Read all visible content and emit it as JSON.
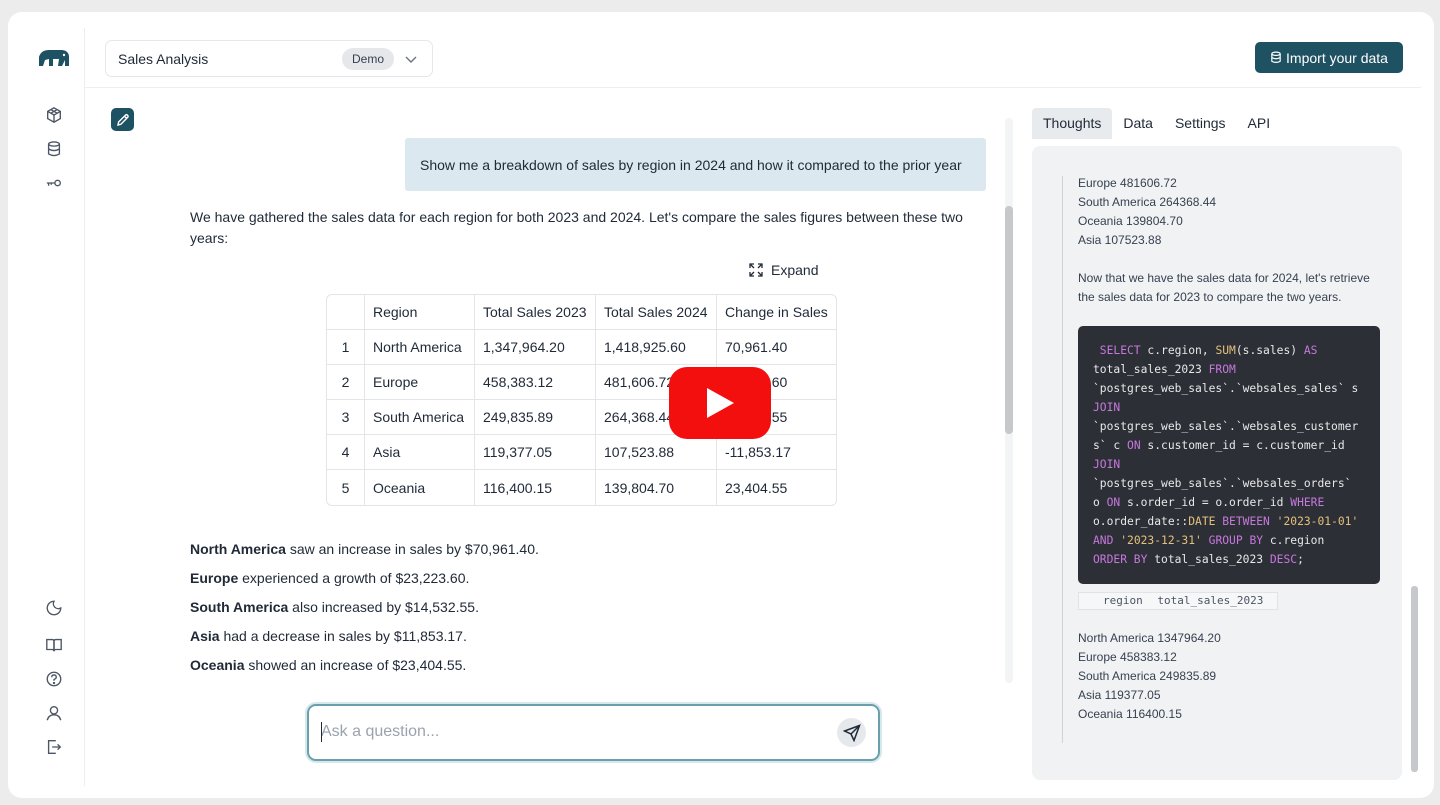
{
  "header": {
    "project_name": "Sales Analysis",
    "project_badge": "Demo",
    "import_label": "Import your data"
  },
  "chat": {
    "user_message": "Show me a breakdown of sales by region in 2024 and how it compared to the prior year",
    "reply_intro": "We have gathered the sales data for each region for both 2023 and 2024. Let's compare the sales figures between these two years:",
    "expand_label": "Expand",
    "table": {
      "headers": [
        "",
        "Region",
        "Total Sales 2023",
        "Total Sales 2024",
        "Change in Sales"
      ],
      "rows": [
        [
          "1",
          "North America",
          "1,347,964.20",
          "1,418,925.60",
          "70,961.40"
        ],
        [
          "2",
          "Europe",
          "458,383.12",
          "481,606.72",
          "23,223.60"
        ],
        [
          "3",
          "South America",
          "249,835.89",
          "264,368.44",
          "14,532.55"
        ],
        [
          "4",
          "Asia",
          "119,377.05",
          "107,523.88",
          "-11,853.17"
        ],
        [
          "5",
          "Oceania",
          "116,400.15",
          "139,804.70",
          "23,404.55"
        ]
      ]
    },
    "summary": [
      {
        "region": "North America",
        "text": " saw an increase in sales by $70,961.40."
      },
      {
        "region": "Europe",
        "text": " experienced a growth of $23,223.60."
      },
      {
        "region": "South America",
        "text": " also increased by $14,532.55."
      },
      {
        "region": "Asia",
        "text": " had a decrease in sales by $11,853.17."
      },
      {
        "region": "Oceania",
        "text": " showed an increase of $23,404.55."
      }
    ],
    "input_placeholder": "Ask a question..."
  },
  "panel": {
    "tabs": [
      "Thoughts",
      "Data",
      "Settings",
      "API"
    ],
    "active_tab": "Thoughts",
    "sales_2024_lines": [
      "Europe 481606.72",
      "South America 264368.44",
      "Oceania 139804.70",
      "Asia 107523.88"
    ],
    "thought": "Now that we have the sales data for 2024, let's retrieve the sales data for 2023 to compare the two years.",
    "sql_lines": [
      " SELECT c.region, SUM(s.sales) AS",
      "total_sales_2023 FROM",
      "`postgres_web_sales`.`websales_sales` s",
      "JOIN",
      "`postgres_web_sales`.`websales_customer",
      "s` c ON s.customer_id = c.customer_id",
      "JOIN",
      "`postgres_web_sales`.`websales_orders`",
      "o ON s.order_id = o.order_id WHERE",
      "o.order_date::DATE BETWEEN '2023-01-01'",
      "AND '2023-12-31' GROUP BY c.region",
      "ORDER BY total_sales_2023 DESC;"
    ],
    "result_columns": [
      "region",
      "total_sales_2023"
    ],
    "sales_2023_lines": [
      "North America 1347964.20",
      "Europe 458383.12",
      "South America 249835.89",
      "Asia 119377.05",
      "Oceania 116400.15"
    ]
  },
  "colors": {
    "brand": "#1e5161",
    "user_bubble": "#dbe8ef",
    "code_bg": "#2c2f36",
    "play_button": "#f40f0f"
  },
  "icons": {
    "rail_top": [
      "cube-icon",
      "database-icon",
      "key-icon"
    ],
    "rail_bottom": [
      "moon-icon",
      "book-icon",
      "help-icon",
      "user-icon",
      "logout-icon"
    ]
  }
}
